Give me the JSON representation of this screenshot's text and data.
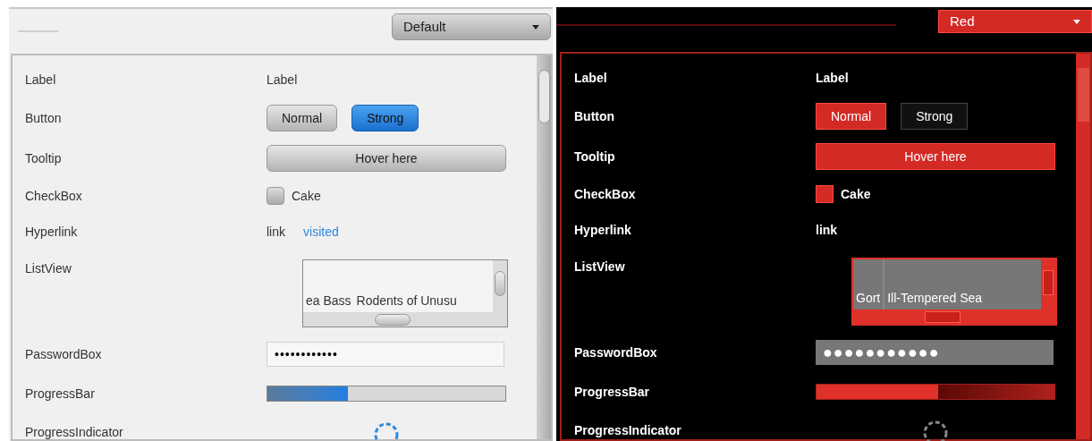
{
  "panels": [
    {
      "kind": "default",
      "dropdown": "Default",
      "rows": [
        {
          "kind": "label",
          "name": "Label",
          "text": "Label"
        },
        {
          "kind": "buttons",
          "name": "Button",
          "buttons": [
            {
              "label": "Normal",
              "strong": false
            },
            {
              "label": "Strong",
              "strong": true
            }
          ]
        },
        {
          "kind": "tooltip",
          "name": "Tooltip",
          "button": "Hover here"
        },
        {
          "kind": "checkbox",
          "name": "CheckBox",
          "label": "Cake",
          "checked": false
        },
        {
          "kind": "hyperlink",
          "name": "Hyperlink",
          "links": [
            {
              "text": "link",
              "visited": false
            },
            {
              "text": "visited",
              "visited": true
            }
          ]
        },
        {
          "kind": "listview",
          "name": "ListView",
          "items": [
            "ea Bass",
            "Rodents of Unusu"
          ]
        },
        {
          "kind": "password",
          "name": "PasswordBox",
          "value": "••••••••••••"
        },
        {
          "kind": "progressbar",
          "name": "ProgressBar",
          "level": 0.34
        },
        {
          "kind": "indicator",
          "name": "ProgressIndicator"
        }
      ]
    },
    {
      "kind": "red",
      "dropdown": "Red",
      "rows": [
        {
          "kind": "label",
          "name": "Label",
          "text": "Label"
        },
        {
          "kind": "buttons",
          "name": "Button",
          "buttons": [
            {
              "label": "Normal",
              "strong": false
            },
            {
              "label": "Strong",
              "strong": true
            }
          ]
        },
        {
          "kind": "tooltip",
          "name": "Tooltip",
          "button": "Hover here"
        },
        {
          "kind": "checkbox",
          "name": "CheckBox",
          "label": "Cake",
          "checked": false
        },
        {
          "kind": "hyperlink",
          "name": "Hyperlink",
          "links": [
            {
              "text": "link",
              "visited": false
            }
          ]
        },
        {
          "kind": "listview",
          "name": "ListView",
          "items": [
            "Gort",
            "Ill-Tempered Sea"
          ]
        },
        {
          "kind": "password",
          "name": "PasswordBox",
          "value": "●●●●●●●●●●●"
        },
        {
          "kind": "progressbar",
          "name": "ProgressBar",
          "level": 0.51
        },
        {
          "kind": "indicator",
          "name": "ProgressIndicator"
        }
      ]
    }
  ]
}
